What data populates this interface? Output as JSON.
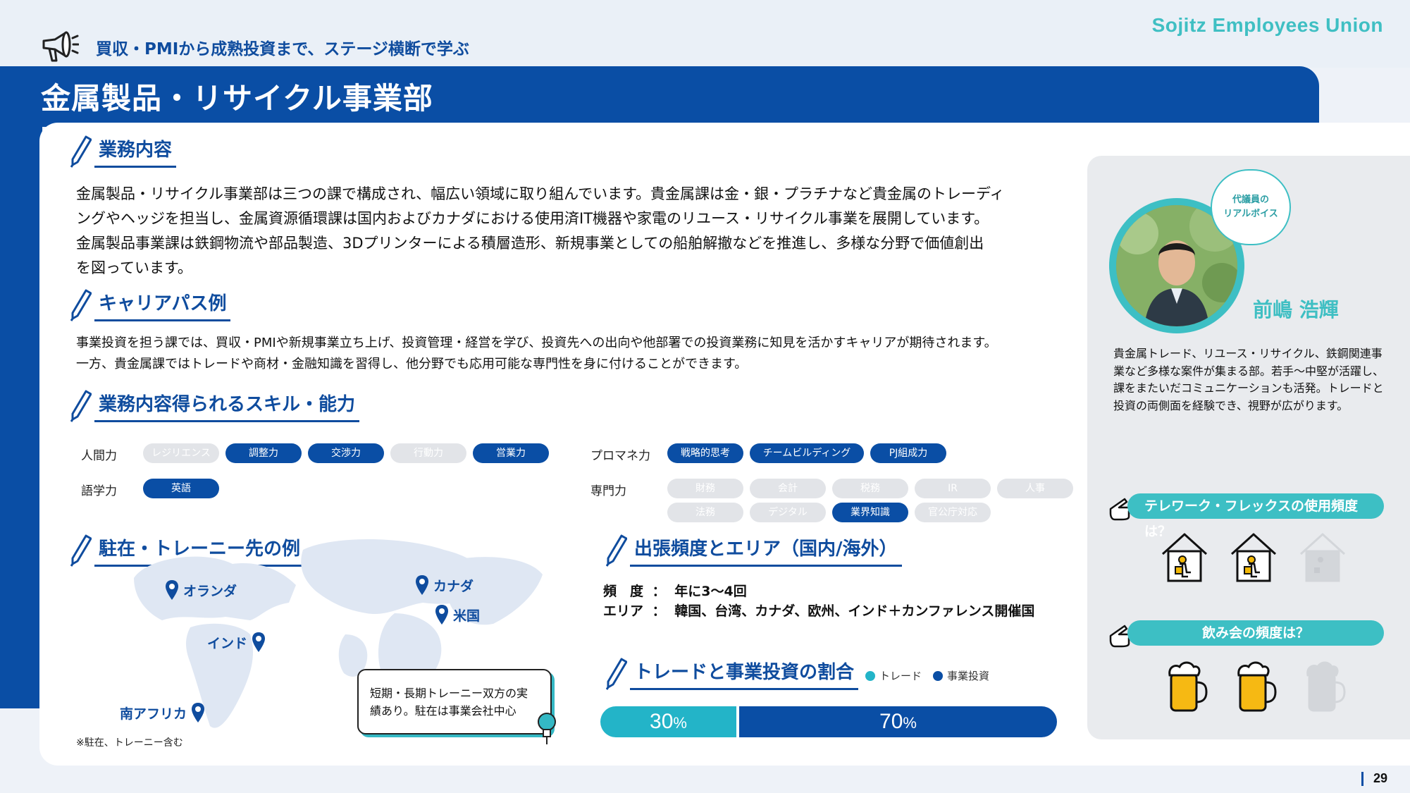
{
  "header": {
    "brand": "Sojitz Employees Union",
    "subtitle": "買収・PMIから成熟投資まで、ステージ横断で学ぶ",
    "title": "金属製品・リサイクル事業部",
    "page_number": "29"
  },
  "sections": {
    "business": {
      "heading": "業務内容",
      "lines": [
        "金属製品・リサイクル事業部は三つの課で構成され、幅広い領域に取り組んでいます。貴金属課は金・銀・プラチナなど貴金属のトレーディ",
        "ングやヘッジを担当し、金属資源循環課は国内およびカナダにおける使用済IT機器や家電のリユース・リサイクル事業を展開しています。",
        "金属製品事業課は鉄鋼物流や部品製造、3Dプリンターによる積層造形、新規事業としての船舶解撤などを推進し、多様な分野で価値創出",
        "を図っています。"
      ]
    },
    "career": {
      "heading": "キャリアパス例",
      "lines": [
        "事業投資を担う課では、買収・PMIや新規事業立ち上げ、投資管理・経営を学び、投資先への出向や他部署での投資業務に知見を活かすキャリアが期待されます。",
        "一方、貴金属課ではトレードや商材・金融知識を習得し、他分野でも応用可能な専門性を身に付けることができます。"
      ]
    },
    "skills": {
      "heading": "業務内容得られるスキル・能力",
      "human": {
        "label": "人間力",
        "pills": [
          {
            "text": "レジリエンス",
            "on": false
          },
          {
            "text": "調整力",
            "on": true
          },
          {
            "text": "交渉力",
            "on": true
          },
          {
            "text": "行動力",
            "on": false
          },
          {
            "text": "営業力",
            "on": true
          }
        ]
      },
      "language": {
        "label": "語学力",
        "pills": [
          {
            "text": "英語",
            "on": true
          }
        ]
      },
      "pm": {
        "label": "プロマネ力",
        "pills": [
          {
            "text": "戦略的思考",
            "on": true
          },
          {
            "text": "チームビルディング",
            "on": true
          },
          {
            "text": "PJ組成力",
            "on": true
          }
        ]
      },
      "expert": {
        "label": "専門力",
        "pills": [
          {
            "text": "財務",
            "on": false
          },
          {
            "text": "会計",
            "on": false
          },
          {
            "text": "税務",
            "on": false
          },
          {
            "text": "IR",
            "on": false
          },
          {
            "text": "人事",
            "on": false
          },
          {
            "text": "法務",
            "on": false
          },
          {
            "text": "デジタル",
            "on": false
          },
          {
            "text": "業界知識",
            "on": true
          },
          {
            "text": "官公庁対応",
            "on": false
          }
        ]
      }
    },
    "posting": {
      "heading": "駐在・トレーニー先の例",
      "pins": [
        "オランダ",
        "カナダ",
        "米国",
        "インド",
        "南アフリカ"
      ],
      "callout": [
        "短期・長期トレーニー双方の実",
        "績あり。駐在は事業会社中心"
      ],
      "note": "※駐在、トレーニー含む"
    },
    "travel": {
      "heading": "出張頻度とエリア（国内/海外）",
      "freq_label": "頻　度",
      "freq_value": "年に3～4回",
      "area_label": "エリア",
      "area_value": "韓国、台湾、カナダ、欧州、インド＋カンファレンス開催国",
      "sep": "："
    },
    "ratio": {
      "heading": "トレードと事業投資の割合",
      "legend_trade": "トレード",
      "legend_invest": "事業投資",
      "trade_pct": 30,
      "invest_pct": 70,
      "trade_num": "30",
      "invest_num": "70",
      "unit": "%",
      "colors": {
        "trade": "#23b4c8",
        "invest": "#0a4ea5"
      }
    }
  },
  "voice": {
    "bubble": [
      "代議員の",
      "リアルボイス"
    ],
    "name": "前嶋 浩輝",
    "quote": "貴金属トレード、リユース・リサイクル、鉄鋼関連事業など多様な案件が集まる部。若手～中堅が活躍し、課をまたいだコミュニケーションも活発。トレードと投資の両側面を経験でき、視野が広がります。",
    "telework_q": "テレワーク・フレックスの使用頻度は？",
    "telework_level": 2,
    "telework_max": 3,
    "drink_q": "飲み会の頻度は？",
    "drink_level": 2,
    "drink_max": 3
  }
}
